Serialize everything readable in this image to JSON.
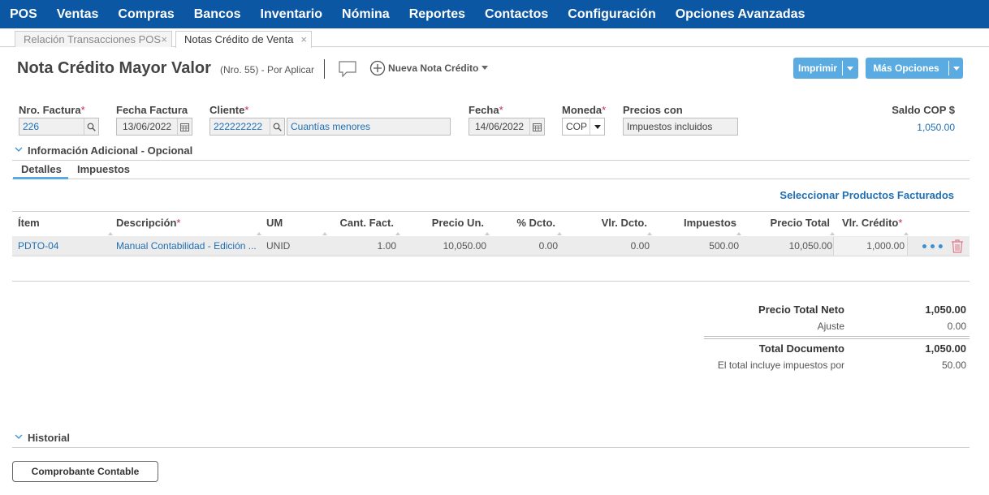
{
  "nav": {
    "items": [
      {
        "label": "POS"
      },
      {
        "label": "Ventas"
      },
      {
        "label": "Compras"
      },
      {
        "label": "Bancos"
      },
      {
        "label": "Inventario"
      },
      {
        "label": "Nómina"
      },
      {
        "label": "Reportes"
      },
      {
        "label": "Contactos"
      },
      {
        "label": "Configuración"
      },
      {
        "label": "Opciones Avanzadas"
      }
    ]
  },
  "tabs": [
    {
      "label": "Relación Transacciones POS",
      "close": "×"
    },
    {
      "label": "Notas Crédito de Venta",
      "close": "×"
    }
  ],
  "header": {
    "title": "Nota Crédito Mayor Valor",
    "subtitle": "(Nro. 55) - Por Aplicar",
    "new_note_label": "Nueva Nota Crédito",
    "print_label": "Imprimir",
    "more_label": "Más Opciones"
  },
  "form": {
    "invoice_no": {
      "label": "Nro. Factura",
      "req": "*",
      "value": "226"
    },
    "invoice_date": {
      "label": "Fecha Factura",
      "value": "13/06/2022"
    },
    "client": {
      "label": "Cliente",
      "req": "*",
      "value": "222222222",
      "name": "Cuantías menores"
    },
    "date": {
      "label": "Fecha",
      "req": "*",
      "value": "14/06/2022"
    },
    "currency": {
      "label": "Moneda",
      "req": "*",
      "value": "COP"
    },
    "prices_with": {
      "label": "Precios con",
      "value": "Impuestos incluidos"
    },
    "balance": {
      "label": "Saldo COP $",
      "value": "1,050.00"
    }
  },
  "sections": {
    "additional_info": "Información Adicional - Opcional",
    "history": "Historial"
  },
  "subtabs": {
    "details": "Detalles",
    "taxes": "Impuestos"
  },
  "select_products_label": "Seleccionar Productos Facturados",
  "table": {
    "headers": {
      "item": "Ítem",
      "description": "Descripción",
      "um": "UM",
      "qty": "Cant. Fact.",
      "unit_price": "Precio Un.",
      "disc_pct": "% Dcto.",
      "disc_val": "Vlr. Dcto.",
      "taxes": "Impuestos",
      "total_price": "Precio Total",
      "credit_val": "Vlr. Crédito",
      "req": "*"
    },
    "rows": [
      {
        "item": "PDTO-04",
        "description": "Manual Contabilidad - Edición ...",
        "um": "UNID",
        "qty": "1.00",
        "unit_price": "10,050.00",
        "disc_pct": "0.00",
        "disc_val": "0.00",
        "taxes": "500.00",
        "total_price": "10,050.00",
        "credit_val": "1,000.00",
        "more": "•••"
      }
    ]
  },
  "totals": {
    "net_label": "Precio Total Neto",
    "net_value": "1,050.00",
    "adjust_label": "Ajuste",
    "adjust_value": "0.00",
    "doc_label": "Total Documento",
    "doc_value": "1,050.00",
    "tax_label": "El total incluye impuestos por",
    "tax_value": "50.00"
  },
  "footer": {
    "accounting_button": "Comprobante Contable"
  },
  "colors": {
    "nav_bg": "#0b57a4",
    "accent_blue": "#5aabe1",
    "link": "#1f6fb2",
    "required": "#c0304a",
    "trash": "#e07a8a"
  },
  "icons": {
    "search": "search-icon",
    "calendar": "calendar-icon",
    "comment": "comment-icon",
    "plus": "plus-circle-icon",
    "trash": "trash-icon",
    "chevron": "chevron-down-icon"
  }
}
